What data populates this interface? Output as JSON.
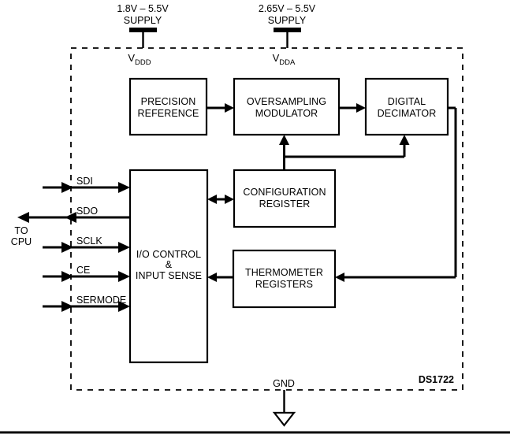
{
  "diagram": {
    "part_number": "DS1722",
    "supplies": [
      {
        "id": "vddd",
        "range": "1.8V – 5.5V",
        "word": "SUPPLY",
        "rail": "V",
        "rail_sub": "DDD"
      },
      {
        "id": "vdda",
        "range": "2.65V – 5.5V",
        "word": "SUPPLY",
        "rail": "V",
        "rail_sub": "DDA"
      }
    ],
    "ground": {
      "label": "GND"
    },
    "cpu": {
      "line1": "TO",
      "line2": "CPU"
    },
    "pins": [
      {
        "name": "SDI",
        "direction": "in"
      },
      {
        "name": "SDO",
        "direction": "out"
      },
      {
        "name": "SCLK",
        "direction": "in"
      },
      {
        "name": "CE",
        "direction": "in"
      },
      {
        "name": "SERMODE",
        "direction": "in"
      }
    ],
    "blocks": [
      {
        "id": "precision-reference",
        "line1": "PRECISION",
        "line2": "REFERENCE"
      },
      {
        "id": "oversampling-modulator",
        "line1": "OVERSAMPLING",
        "line2": "MODULATOR"
      },
      {
        "id": "digital-decimator",
        "line1": "DIGITAL",
        "line2": "DECIMATOR"
      },
      {
        "id": "io-control",
        "line1": "I/O CONTROL",
        "line2": "&",
        "line3": "INPUT SENSE"
      },
      {
        "id": "configuration-register",
        "line1": "CONFIGURATION",
        "line2": "REGISTER"
      },
      {
        "id": "thermometer-registers",
        "line1": "THERMOMETER",
        "line2": "REGISTERS"
      }
    ],
    "colors": {
      "line": "#000000",
      "background": "#ffffff",
      "block_fill": "#ffffff"
    }
  }
}
